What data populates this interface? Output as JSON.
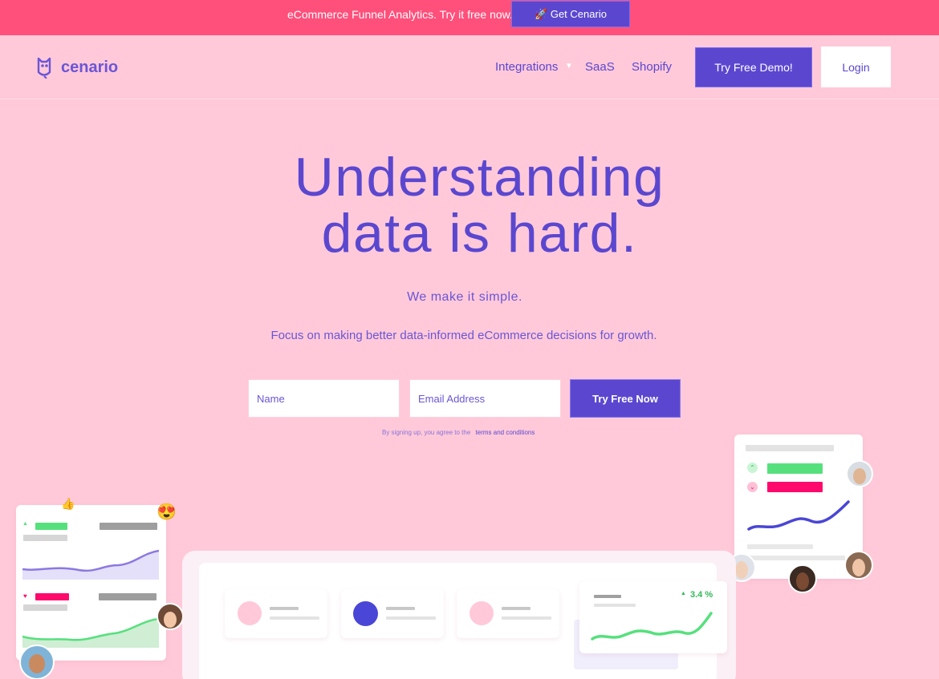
{
  "promo": {
    "text": "eCommerce Funnel Analytics. Try it free now.",
    "button_label": "🚀 Get Cenario"
  },
  "nav": {
    "logo_text": "cenario",
    "links": [
      "Integrations",
      "SaaS",
      "Shopify"
    ],
    "demo_button": "Try Free Demo!",
    "login_button": "Login"
  },
  "hero": {
    "title_line1": "Understanding",
    "title_line2": "data is hard.",
    "subtitle": "We make it simple.",
    "description": "Focus on making better data-informed eCommerce decisions for growth."
  },
  "signup": {
    "name_placeholder": "Name",
    "email_placeholder": "Email Address",
    "button_label": "Try Free Now",
    "terms_text": "By signing up, you agree to the",
    "terms_link": "terms and conditions"
  },
  "dashboard": {
    "growth_stat": "3.4 %"
  },
  "colors": {
    "accent": "#5b47cf",
    "promo_bar": "#ff4f7b",
    "background": "#ffc9d9",
    "positive": "#56e07d",
    "negative": "#ff0a6c"
  }
}
